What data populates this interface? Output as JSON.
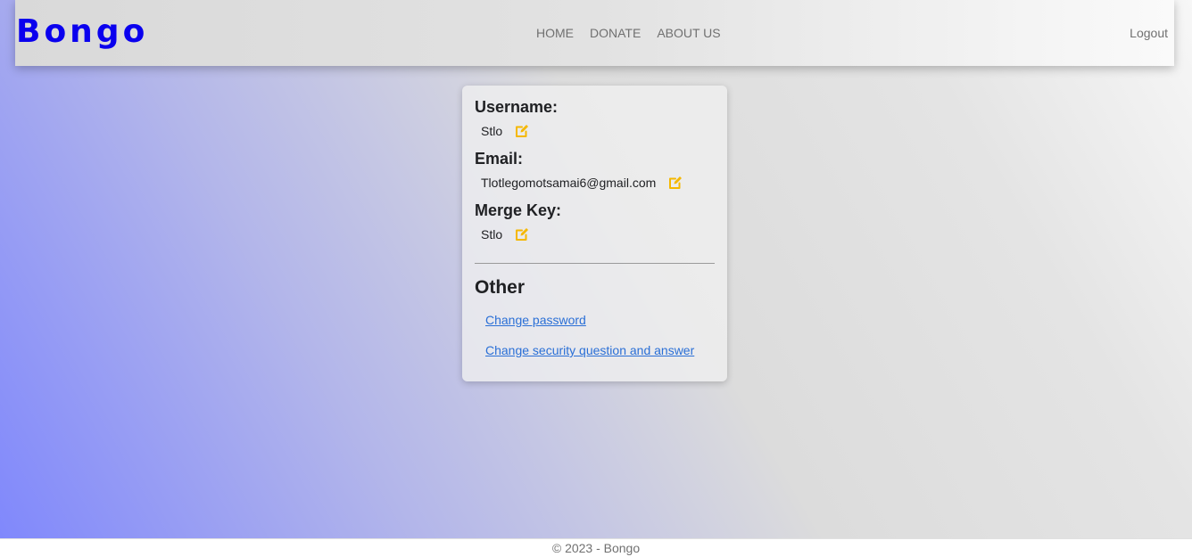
{
  "header": {
    "brand": "Bongo",
    "nav": [
      {
        "label": "HOME"
      },
      {
        "label": "DONATE"
      },
      {
        "label": "ABOUT US"
      }
    ],
    "logout": "Logout"
  },
  "profile": {
    "username_label": "Username:",
    "username_value": "Stlo",
    "email_label": "Email:",
    "email_value": "Tlotlegomotsamai6@gmail.com",
    "merge_key_label": "Merge Key:",
    "merge_key_value": "Stlo",
    "edit_icon": "edit-icon",
    "edit_icon_color": "#f5b800"
  },
  "other": {
    "title": "Other",
    "links": [
      {
        "label": "Change password"
      },
      {
        "label": "Change security question and answer"
      }
    ]
  },
  "footer": {
    "text": "© 2023 - Bongo"
  },
  "colors": {
    "brand": "#0a00ee",
    "link": "#2a6fd6",
    "accent": "#f5b800"
  }
}
